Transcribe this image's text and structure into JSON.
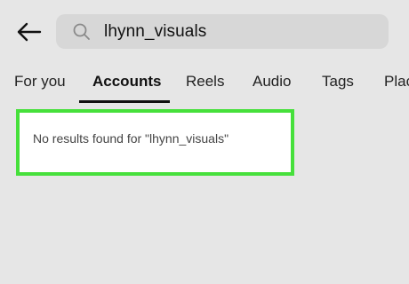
{
  "search": {
    "query": "lhynn_visuals"
  },
  "tabs": [
    {
      "label": "For you"
    },
    {
      "label": "Accounts"
    },
    {
      "label": "Reels"
    },
    {
      "label": "Audio"
    },
    {
      "label": "Tags"
    },
    {
      "label": "Plac"
    }
  ],
  "active_tab": "Accounts",
  "results": {
    "empty_message": "No results found for \"lhynn_visuals\""
  },
  "icons": {
    "back": "back-arrow-icon",
    "search": "search-icon"
  },
  "colors": {
    "background": "#e6e6e6",
    "search_field": "#d7d7d7",
    "highlight_border": "#46e03b",
    "active_underline": "#111111"
  }
}
